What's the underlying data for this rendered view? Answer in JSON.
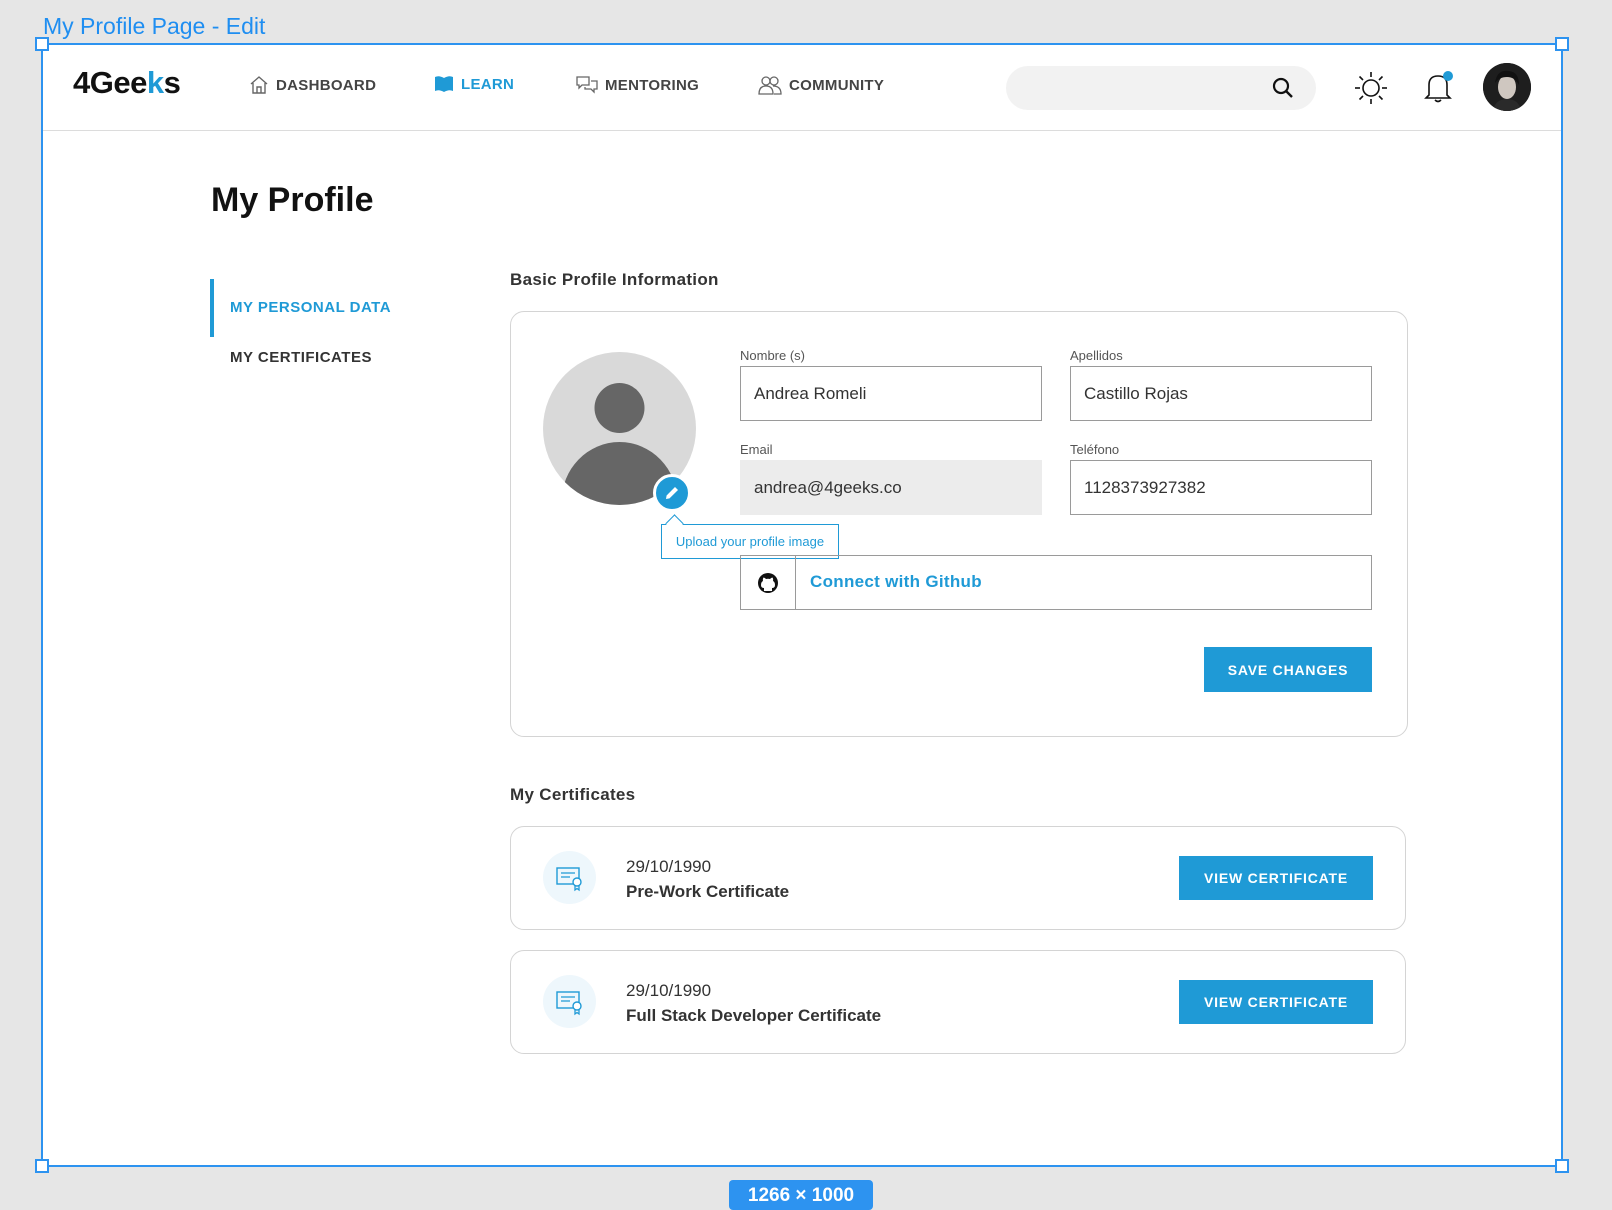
{
  "frame": {
    "label": "My Profile Page - Edit",
    "size_badge": "1266 × 1000"
  },
  "navbar": {
    "logo_prefix": "4Gee",
    "logo_accent": "k",
    "logo_suffix": "s",
    "items": [
      {
        "label": "DASHBOARD",
        "icon": "home-icon",
        "active": false
      },
      {
        "label": "LEARN",
        "icon": "book-icon",
        "active": true
      },
      {
        "label": "MENTORING",
        "icon": "chat-icon",
        "active": false
      },
      {
        "label": "COMMUNITY",
        "icon": "users-icon",
        "active": false
      }
    ],
    "search": {
      "value": "",
      "placeholder": ""
    }
  },
  "page": {
    "title": "My Profile"
  },
  "sidebar": {
    "items": [
      {
        "label": "MY PERSONAL DATA",
        "active": true
      },
      {
        "label": "MY CERTIFICATES",
        "active": false
      }
    ]
  },
  "profile": {
    "section_title": "Basic Profile Information",
    "upload_tooltip": "Upload your profile image",
    "fields": {
      "first_name": {
        "label": "Nombre (s)",
        "value": "Andrea Romeli"
      },
      "last_name": {
        "label": "Apellidos",
        "value": "Castillo Rojas"
      },
      "email": {
        "label": "Email",
        "value": "andrea@4geeks.co"
      },
      "phone": {
        "label": "Teléfono",
        "value": "1128373927382"
      }
    },
    "github_label": "Connect with Github",
    "save_label": "SAVE CHANGES"
  },
  "certificates": {
    "section_title": "My Certificates",
    "items": [
      {
        "date": "29/10/1990",
        "name": "Pre-Work Certificate",
        "button": "VIEW CERTIFICATE"
      },
      {
        "date": "29/10/1990",
        "name": "Full Stack Developer Certificate",
        "button": "VIEW CERTIFICATE"
      }
    ]
  },
  "colors": {
    "accent": "#1f9ad6",
    "frame_selection": "#2d93f0"
  }
}
